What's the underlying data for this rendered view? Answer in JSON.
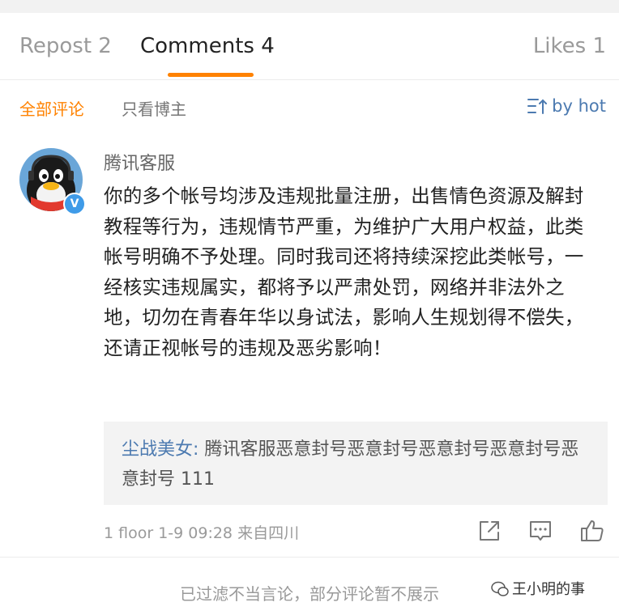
{
  "tabs": {
    "repost": "Repost 2",
    "comments": "Comments 4",
    "likes": "Likes 1"
  },
  "filter": {
    "all": "全部评论",
    "owner_only": "只看博主",
    "sort": "by hot"
  },
  "comment": {
    "username": "腾讯客服",
    "text": "你的多个帐号均涉及违规批量注册，出售情色资源及解封教程等行为，违规情节严重，为维护广大用户权益，此类帐号明确不予处理。同时我司还将持续深挖此类帐号，一经核实违规属实，都将予以严肃处罚，网络并非法外之地，切勿在青春年华以身试法，影响人生规划得不偿失，还请正视帐号的违规及恶劣影响！",
    "reply_user": "尘战美女:",
    "reply_text": " 腾讯客服恶意封号恶意封号恶意封号恶意封号恶意封号 111",
    "meta": "1 floor 1-9 09:28 来自四川"
  },
  "notice": "已过滤不当言论，部分评论暂不展示",
  "watermark": "王小明的事",
  "colors": {
    "accent": "#ff8200",
    "link": "#4c7ab0",
    "verified": "#3f9be8"
  }
}
